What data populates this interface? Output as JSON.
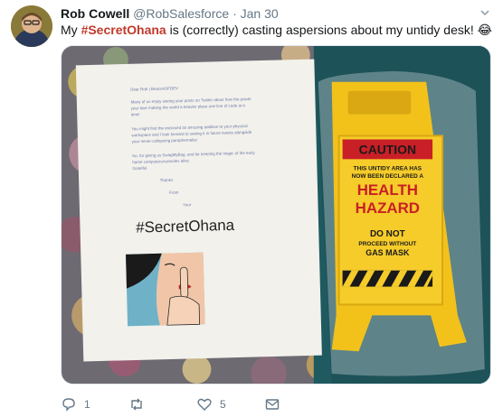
{
  "tweet": {
    "author_name": "Rob Cowell",
    "author_handle": "@RobSalesforce",
    "separator": "·",
    "date": "Jan 30",
    "text_before": "My ",
    "hashtag": "#SecretOhana",
    "text_after": " is (correctly) casting aspersions about my untidy desk! 😂"
  },
  "media": {
    "letter_hashtag": "#SecretOhana",
    "letter_lines": [
      "Dear Rob | BeaconSFDEV",
      "Many of us enjoy seeing your posts on Twitter about how the power",
      "your love making the world a heavier place one line of code at a",
      "time!",
      "You might find the enclosed an amusing addition to your physical",
      "workspace and I look forward to seeing it in future tweets alongside",
      "your never-collapsing paraphernalia!",
      "So, for giving us SwagMyBag, and for keeping the magic of the early",
      "home computers/consoles alive.",
      "Grateful",
      "Thanks",
      "From",
      "Your"
    ],
    "sign": {
      "caution": "CAUTION",
      "line1": "THIS UNTIDY AREA HAS",
      "line2": "NOW BEEN DECLARED A",
      "health": "HEALTH",
      "hazard": "HAZARD",
      "do_not": "DO NOT",
      "proceed": "PROCEED WITHOUT",
      "gas_mask": "GAS MASK"
    }
  },
  "actions": {
    "reply_count": "1",
    "retweet_count": "",
    "like_count": "5"
  },
  "colors": {
    "hashtag": "#c0392b",
    "sign_yellow": "#f2c21b",
    "muted": "#657786"
  }
}
